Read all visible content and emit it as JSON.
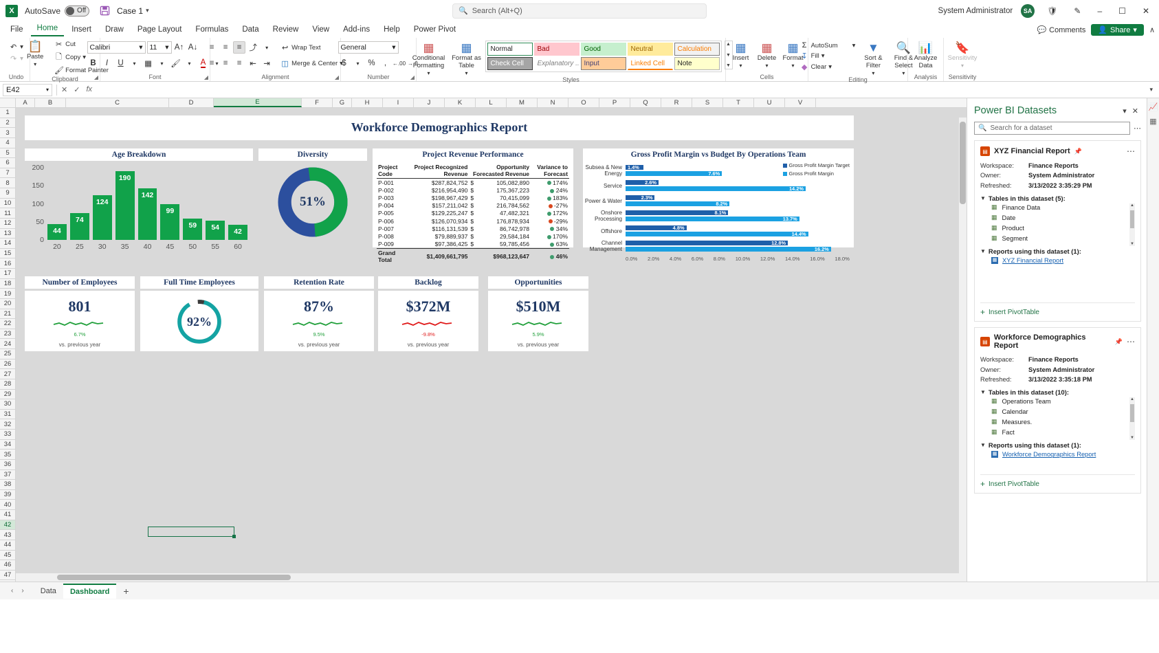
{
  "titlebar": {
    "app_icon": "excel-icon",
    "autosave_label": "AutoSave",
    "autosave_state": "Off",
    "save_icon": "save-icon",
    "filename": "Case 1",
    "search_placeholder": "Search (Alt+Q)",
    "user": "System Administrator",
    "avatar_initials": "SA",
    "minimize": "–",
    "maximize": "☐",
    "close": "✕"
  },
  "ribbon_tabs": [
    {
      "label": "File",
      "active": false
    },
    {
      "label": "Home",
      "active": true
    },
    {
      "label": "Insert",
      "active": false
    },
    {
      "label": "Draw",
      "active": false
    },
    {
      "label": "Page Layout",
      "active": false
    },
    {
      "label": "Formulas",
      "active": false
    },
    {
      "label": "Data",
      "active": false
    },
    {
      "label": "Review",
      "active": false
    },
    {
      "label": "View",
      "active": false
    },
    {
      "label": "Add-ins",
      "active": false
    },
    {
      "label": "Help",
      "active": false
    },
    {
      "label": "Power Pivot",
      "active": false
    }
  ],
  "ribbon_right": {
    "comments": "Comments",
    "share": "Share",
    "collapse": "∧"
  },
  "ribbon": {
    "undo_group": "Undo",
    "clipboard_group": "Clipboard",
    "paste": "Paste",
    "cut": "Cut",
    "copy": "Copy",
    "format_painter": "Format Painter",
    "font_group": "Font",
    "font_name": "Calibri",
    "font_size": "11",
    "alignment_group": "Alignment",
    "wrap_text": "Wrap Text",
    "merge_center": "Merge & Center",
    "number_group": "Number",
    "number_format": "General",
    "conditional_formatting": "Conditional Formatting",
    "format_as_table": "Format as Table",
    "styles_group": "Styles",
    "style_cells": [
      {
        "label": "Normal",
        "bg": "#ffffff",
        "fg": "#222222",
        "border": "#2e8b57"
      },
      {
        "label": "Check Cell",
        "bg": "#a5a5a5",
        "fg": "#ffffff",
        "border": "#3f3f3f"
      },
      {
        "label": "Bad",
        "bg": "#ffc7ce",
        "fg": "#9c0006",
        "border": "transparent"
      },
      {
        "label": "Explanatory ...",
        "bg": "#ffffff",
        "fg": "#7f7f7f",
        "border": "transparent"
      },
      {
        "label": "Good",
        "bg": "#c6efce",
        "fg": "#006100",
        "border": "transparent"
      },
      {
        "label": "Input",
        "bg": "#ffcc99",
        "fg": "#3f3f76",
        "border": "#7f7f7f"
      },
      {
        "label": "Neutral",
        "bg": "#ffeb9c",
        "fg": "#9c6500",
        "border": "transparent"
      },
      {
        "label": "Linked Cell",
        "bg": "#ffffff",
        "fg": "#fa7d00",
        "border": "transparent"
      },
      {
        "label": "Calculation",
        "bg": "#f2f2f2",
        "fg": "#fa7d00",
        "border": "#7f7f7f"
      },
      {
        "label": "Note",
        "bg": "#ffffcc",
        "fg": "#222222",
        "border": "#b2b2b2"
      }
    ],
    "cells_group": "Cells",
    "insert": "Insert",
    "delete": "Delete",
    "format": "Format",
    "editing_group": "Editing",
    "autosum": "AutoSum",
    "fill": "Fill",
    "clear": "Clear",
    "sort_filter": "Sort & Filter",
    "find_select": "Find & Select",
    "analysis_group": "Analysis",
    "analyze_data": "Analyze Data",
    "sensitivity_group": "Sensitivity",
    "sensitivity": "Sensitivity"
  },
  "formula_bar": {
    "name_box": "E42",
    "cancel": "✕",
    "enter": "✓",
    "fx": "fx",
    "value": ""
  },
  "grid": {
    "columns": [
      "A",
      "B",
      "C",
      "D",
      "E",
      "F",
      "G",
      "H",
      "I",
      "J",
      "K",
      "L",
      "M",
      "N",
      "O",
      "P",
      "Q",
      "R",
      "S",
      "T",
      "U",
      "V"
    ],
    "selected_column": "E",
    "selected_row": "42",
    "rows": [
      "1",
      "2",
      "3",
      "4",
      "5",
      "6",
      "7",
      "8",
      "9",
      "10",
      "11",
      "12",
      "13",
      "14",
      "15",
      "16",
      "17",
      "18",
      "19",
      "20",
      "21",
      "22",
      "23",
      "24",
      "25",
      "26",
      "27",
      "28",
      "29",
      "30",
      "31",
      "32",
      "33",
      "34",
      "35",
      "36",
      "37",
      "38",
      "39",
      "40",
      "41",
      "42",
      "43",
      "44",
      "45",
      "46",
      "47"
    ]
  },
  "dashboard": {
    "report_title": "Workforce Demographics Report",
    "age_card_title": "Age Breakdown",
    "diversity_card_title": "Diversity",
    "revenue_card_title": "Project Revenue Performance",
    "gp_card_title": "Gross Profit Margin vs Budget By Operations Team",
    "diversity_value": "51%",
    "kpis": [
      {
        "title": "Number of Employees",
        "value": "801",
        "delta": "6.7%",
        "note": "vs. previous year",
        "trend_color": "#22a03c",
        "type": "sparkline"
      },
      {
        "title": "Full Time Employees",
        "value": "92%",
        "delta": "",
        "note": "",
        "trend_color": "#14a3a3",
        "type": "donut"
      },
      {
        "title": "Retention Rate",
        "value": "87%",
        "delta": "9.5%",
        "note": "vs. previous year",
        "trend_color": "#22a03c",
        "type": "sparkline"
      },
      {
        "title": "Backlog",
        "value": "$372M",
        "delta": "-9.8%",
        "note": "vs. previous year",
        "trend_color": "#e01b1b",
        "type": "sparkline"
      },
      {
        "title": "Opportunities",
        "value": "$510M",
        "delta": "5.9%",
        "note": "vs. previous year",
        "trend_color": "#22a03c",
        "type": "sparkline"
      }
    ],
    "revenue_table": {
      "headers": [
        "Project Code",
        "Project Recognized Revenue",
        "Opportunity Forecasted Revenue",
        "Variance to Forecast"
      ],
      "rows": [
        {
          "code": "P-001",
          "recognized": "$287,824,752",
          "forecast": "105,082,890",
          "status": "g",
          "variance": "174%"
        },
        {
          "code": "P-002",
          "recognized": "$216,954,490",
          "forecast": "175,367,223",
          "status": "g",
          "variance": "24%"
        },
        {
          "code": "P-003",
          "recognized": "$198,967,429",
          "forecast": "70,415,099",
          "status": "g",
          "variance": "183%"
        },
        {
          "code": "P-004",
          "recognized": "$157,211,042",
          "forecast": "216,784,562",
          "status": "r",
          "variance": "-27%"
        },
        {
          "code": "P-005",
          "recognized": "$129,225,247",
          "forecast": "47,482,321",
          "status": "g",
          "variance": "172%"
        },
        {
          "code": "P-006",
          "recognized": "$126,070,934",
          "forecast": "176,878,934",
          "status": "r",
          "variance": "-29%"
        },
        {
          "code": "P-007",
          "recognized": "$116,131,539",
          "forecast": "86,742,978",
          "status": "g",
          "variance": "34%"
        },
        {
          "code": "P-008",
          "recognized": "$79,889,937",
          "forecast": "29,584,184",
          "status": "g",
          "variance": "170%"
        },
        {
          "code": "P-009",
          "recognized": "$97,386,425",
          "forecast": "59,785,456",
          "status": "g",
          "variance": "63%"
        }
      ],
      "total": {
        "code": "Grand Total",
        "recognized": "$1,409,661,795",
        "forecast": "$968,123,647",
        "status": "g",
        "variance": "46%"
      }
    }
  },
  "chart_data": [
    {
      "type": "bar",
      "title": "Age Breakdown",
      "categories": [
        "20",
        "25",
        "30",
        "35",
        "40",
        "45",
        "50",
        "55",
        "60"
      ],
      "values": [
        44,
        74,
        124,
        190,
        142,
        99,
        59,
        54,
        42
      ],
      "xlabel": "",
      "ylabel": "",
      "ylim": [
        0,
        200
      ],
      "yticks": [
        "0",
        "50",
        "100",
        "150",
        "200"
      ],
      "grid": false,
      "legend": "none",
      "series_color": "#11a24a"
    },
    {
      "type": "pie",
      "title": "Diversity",
      "categories": [
        "Share",
        "Remainder"
      ],
      "values": [
        51,
        49
      ],
      "center_label": "51%",
      "colors": [
        "#11a24a",
        "#2c4f9e"
      ],
      "legend": "none"
    },
    {
      "type": "bar",
      "title": "Gross Profit Margin vs Budget By Operations Team",
      "orientation": "horizontal",
      "categories": [
        "Subsea & New Energy",
        "Service",
        "Power & Water",
        "Onshore Processing",
        "Offshore",
        "Channel Management"
      ],
      "series": [
        {
          "name": "Gross Profit Margin Target",
          "values": [
            1.4,
            2.6,
            2.3,
            8.1,
            4.8,
            12.8
          ],
          "color": "#1f5fa9"
        },
        {
          "name": "Gross Profit Margin",
          "values": [
            7.6,
            14.2,
            8.2,
            13.7,
            14.4,
            16.2
          ],
          "color": "#1ba1e2"
        }
      ],
      "value_labels": [
        [
          "1.4%",
          "7.6%"
        ],
        [
          "2.6%",
          "14.2%"
        ],
        [
          "2.3%",
          "8.2%"
        ],
        [
          "8.1%",
          "13.7%"
        ],
        [
          "4.8%",
          "14.4%"
        ],
        [
          "12.8%",
          "16.2%"
        ]
      ],
      "xticks": [
        "0.0%",
        "2.0%",
        "4.0%",
        "6.0%",
        "8.0%",
        "10.0%",
        "12.0%",
        "14.0%",
        "16.0%",
        "18.0%"
      ],
      "xlim": [
        0,
        18
      ],
      "legend": "top-right",
      "grid": false
    },
    {
      "type": "table",
      "title": "Project Revenue Performance",
      "columns": [
        "Project Code",
        "Project Recognized Revenue",
        "Opportunity Forecasted Revenue",
        "Variance to Forecast"
      ],
      "rows": [
        [
          "P-001",
          "$287,824,752",
          "105,082,890",
          "174%"
        ],
        [
          "P-002",
          "$216,954,490",
          "175,367,223",
          "24%"
        ],
        [
          "P-003",
          "$198,967,429",
          "70,415,099",
          "183%"
        ],
        [
          "P-004",
          "$157,211,042",
          "216,784,562",
          "-27%"
        ],
        [
          "P-005",
          "$129,225,247",
          "47,482,321",
          "172%"
        ],
        [
          "P-006",
          "$126,070,934",
          "176,878,934",
          "-29%"
        ],
        [
          "P-007",
          "$116,131,539",
          "86,742,978",
          "34%"
        ],
        [
          "P-008",
          "$79,889,937",
          "29,584,184",
          "170%"
        ],
        [
          "P-009",
          "$97,386,425",
          "59,785,456",
          "63%"
        ],
        [
          "Grand Total",
          "$1,409,661,795",
          "$968,123,647",
          "46%"
        ]
      ]
    }
  ],
  "power_bi": {
    "title": "Power BI Datasets",
    "minimize_icon": "chevron-down-icon",
    "close_icon": "close-icon",
    "search_placeholder": "Search for a dataset",
    "more_icon": "ellipsis-icon",
    "insert_pivottable": "Insert PivotTable",
    "labels": {
      "workspace": "Workspace:",
      "owner": "Owner:",
      "refreshed": "Refreshed:"
    },
    "datasets": [
      {
        "name": "XYZ Financial Report",
        "workspace": "Finance Reports",
        "owner": "System Administrator",
        "refreshed": "3/13/2022 3:35:29 PM",
        "tables_header": "Tables in this dataset (5):",
        "tables": [
          "Finance Data",
          "Date",
          "Product",
          "Segment"
        ],
        "reports_header": "Reports using this dataset (1):",
        "reports": [
          "XYZ Financial Report"
        ]
      },
      {
        "name": "Workforce Demographics Report",
        "workspace": "Finance Reports",
        "owner": "System Administrator",
        "refreshed": "3/13/2022 3:35:18 PM",
        "tables_header": "Tables in this dataset (10):",
        "tables": [
          "Operations Team",
          "Calendar",
          "Measures.",
          "Fact"
        ],
        "reports_header": "Reports using this dataset (1):",
        "reports": [
          "Workforce Demographics Report"
        ]
      }
    ]
  },
  "sheet_bar": {
    "prev": "‹",
    "next": "›",
    "tabs": [
      {
        "label": "Data",
        "active": false
      },
      {
        "label": "Dashboard",
        "active": true
      }
    ],
    "add": "+"
  }
}
